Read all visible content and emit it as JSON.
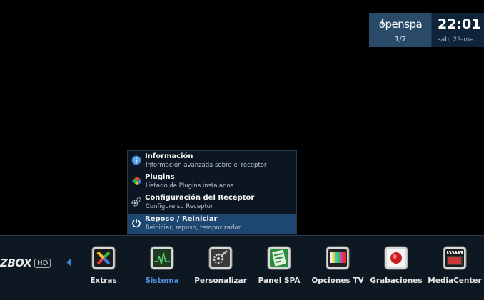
{
  "top_panel": {
    "logo_text": "openspa",
    "page_indicator": "1/7",
    "time": "22:01",
    "date": "sáb, 29-ma"
  },
  "submenu": {
    "items": [
      {
        "title": "Información",
        "subtitle": "Información avanzada sobre el receptor",
        "icon": "info-icon"
      },
      {
        "title": "Plugins",
        "subtitle": "Listado de Plugins instalados",
        "icon": "plugins-icon"
      },
      {
        "title": "Configuración del Receptor",
        "subtitle": "Configure su Receptor",
        "icon": "gears-icon"
      },
      {
        "title": "Reposo / Reiniciar",
        "subtitle": "Reiniciar, reposo, temporizador",
        "icon": "power-icon"
      }
    ],
    "selected_index": 3
  },
  "bottom_bar": {
    "brand": "ZBOX",
    "brand_badge": "HD",
    "items": [
      {
        "label": "Extras",
        "icon": "extras-icon"
      },
      {
        "label": "Sistema",
        "icon": "system-monitor-icon"
      },
      {
        "label": "Personalizar",
        "icon": "personalize-icon"
      },
      {
        "label": "Panel SPA",
        "icon": "panel-spa-icon"
      },
      {
        "label": "Opciones TV",
        "icon": "tv-options-icon"
      },
      {
        "label": "Grabaciones",
        "icon": "recordings-icon"
      },
      {
        "label": "MediaCenter",
        "icon": "mediacenter-icon"
      }
    ],
    "active_index": 1
  },
  "colors": {
    "selection": "#1d4670",
    "active_label": "#4f93e0",
    "logo_panel": "#2a4a6a"
  }
}
